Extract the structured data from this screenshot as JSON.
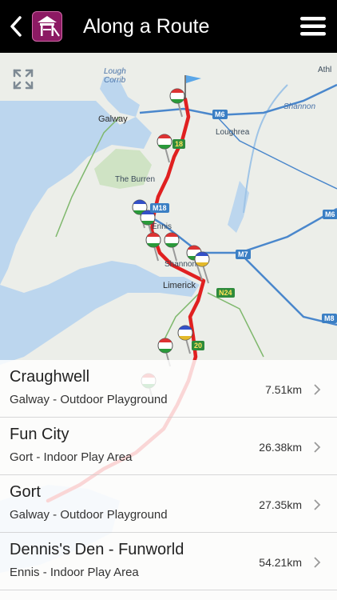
{
  "header": {
    "title": "Along a Route",
    "back_icon": "chevron-left-icon",
    "app_icon": "playground-icon",
    "menu_icon": "hamburger-menu-icon"
  },
  "map": {
    "labels": {
      "lough_corrib": "Lough\nCorrib",
      "galway": "Galway",
      "the_burren": "The Burren",
      "loughrea": "Loughrea",
      "shannon_river": "Shannon",
      "athlone": "Athl",
      "ennis": "Ennis",
      "shannon_town": "Shannon",
      "limerick": "Limerick"
    },
    "roads": {
      "m6": "M6",
      "m18a": "18",
      "m18b": "M18",
      "m7": "M7",
      "m8": "M8",
      "m6_right": "M6",
      "n24": "N24",
      "n20": "20"
    },
    "expand_icon": "expand-arrows-icon",
    "route_color": "#e02020"
  },
  "results": [
    {
      "name": "Craughwell",
      "subtitle": "Galway - Outdoor Playground",
      "distance": "7.51km"
    },
    {
      "name": "Fun City",
      "subtitle": "Gort - Indoor Play Area",
      "distance": "26.38km"
    },
    {
      "name": "Gort",
      "subtitle": "Galway - Outdoor Playground",
      "distance": "27.35km"
    },
    {
      "name": "Dennis's Den - Funworld",
      "subtitle": "Ennis - Indoor Play Area",
      "distance": "54.21km"
    }
  ]
}
